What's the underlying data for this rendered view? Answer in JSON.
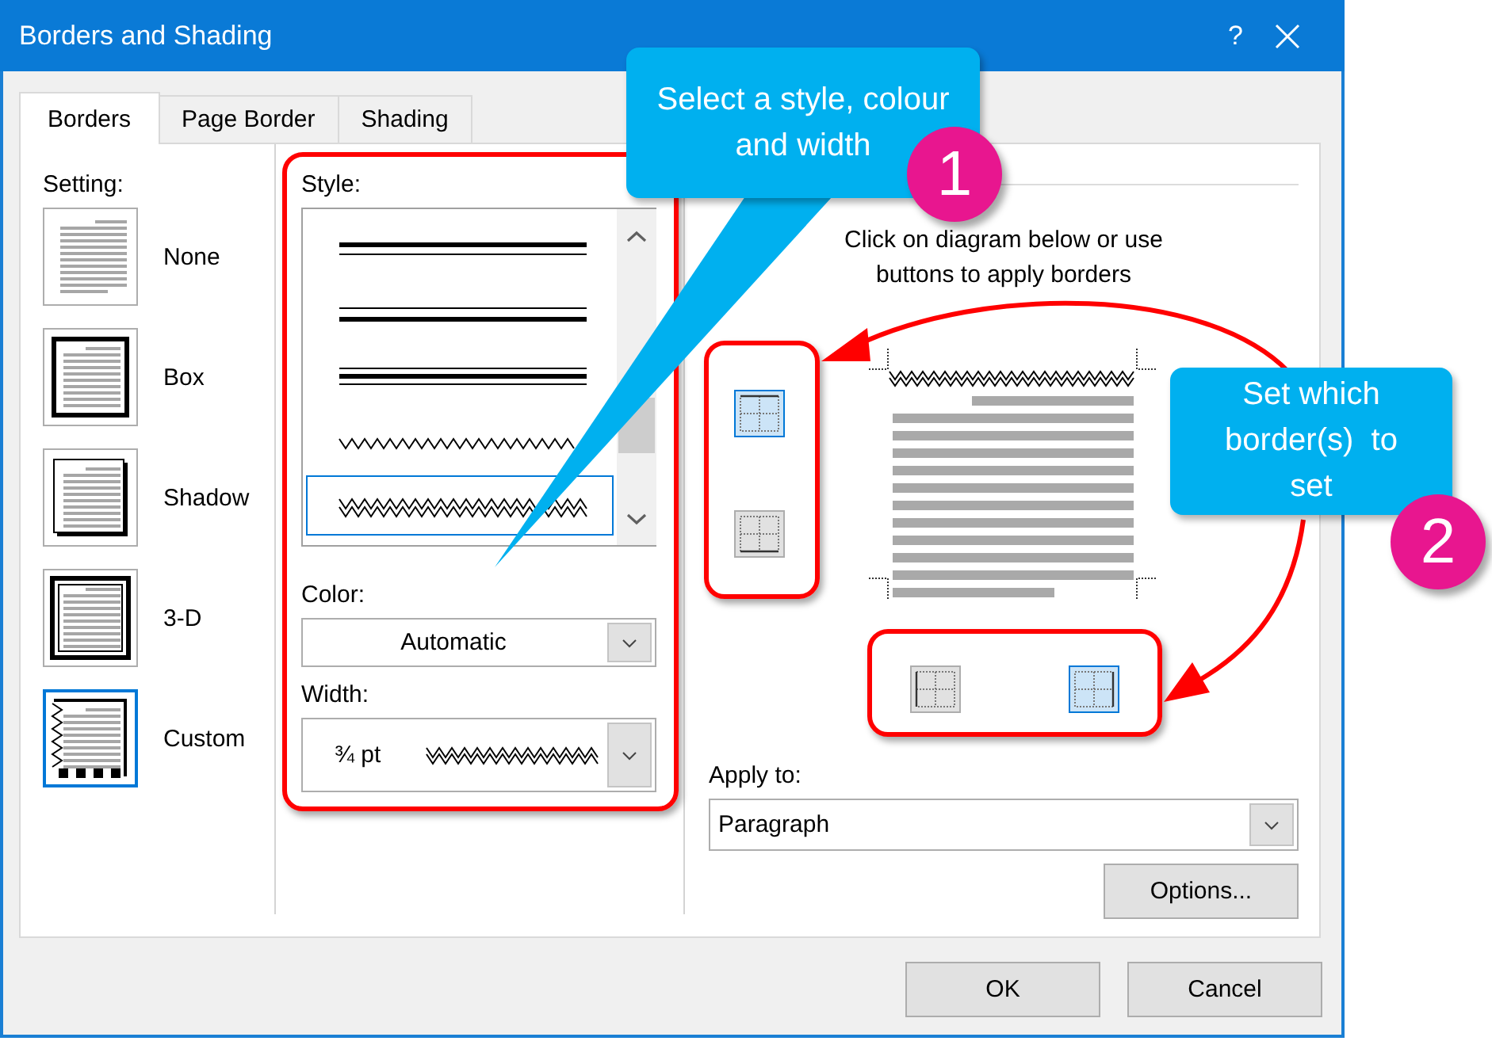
{
  "window": {
    "title": "Borders and Shading",
    "help": "?"
  },
  "tabs": [
    {
      "label": "Borders",
      "selected": true
    },
    {
      "label": "Page Border",
      "selected": false
    },
    {
      "label": "Shading",
      "selected": false
    }
  ],
  "setting": {
    "label": "Setting:",
    "items": [
      {
        "kind": "none",
        "label": "None",
        "selected": false
      },
      {
        "kind": "box",
        "label": "Box",
        "selected": false
      },
      {
        "kind": "shadow",
        "label": "Shadow",
        "selected": false
      },
      {
        "kind": "threed",
        "label": "3-D",
        "selected": false
      },
      {
        "kind": "custom",
        "label": "Custom",
        "selected": true
      }
    ]
  },
  "style": {
    "label": "Style:",
    "items": [
      {
        "kind": "thick-thin",
        "selected": false
      },
      {
        "kind": "thin-thick",
        "selected": false
      },
      {
        "kind": "thin-thick-thin",
        "selected": false
      },
      {
        "kind": "wave",
        "selected": false
      },
      {
        "kind": "double-wave",
        "selected": true
      }
    ]
  },
  "color": {
    "label": "Color:",
    "value": "Automatic"
  },
  "width": {
    "label": "Width:",
    "value": "¾ pt"
  },
  "preview": {
    "instruction": "Click on diagram below or use buttons to apply borders",
    "side_buttons": [
      {
        "kind": "top",
        "selected": true
      },
      {
        "kind": "bottom",
        "selected": false
      }
    ],
    "bottom_buttons": [
      {
        "kind": "left",
        "selected": false
      },
      {
        "kind": "right",
        "selected": true
      }
    ]
  },
  "apply_to": {
    "label": "Apply to:",
    "value": "Paragraph"
  },
  "buttons": {
    "options": "Options...",
    "ok": "OK",
    "cancel": "Cancel"
  },
  "callouts": [
    {
      "text": "Select a style, colour and width",
      "number": "1"
    },
    {
      "text": "Set which border(s)  to set",
      "number": "2"
    }
  ]
}
